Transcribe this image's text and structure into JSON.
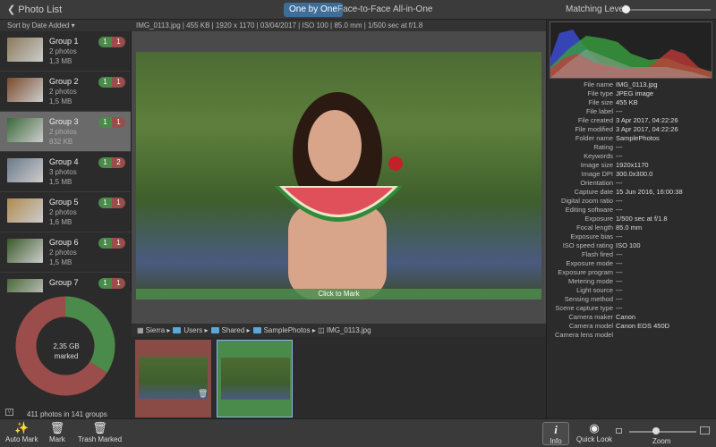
{
  "topbar": {
    "back": "Photo List",
    "modes": [
      "One by One",
      "Face-to-Face",
      "All-in-One"
    ],
    "active_mode": "One by One",
    "matching_label": "Matching Level:",
    "matching_level": 0
  },
  "sort": {
    "label": "Sort by Date Added"
  },
  "infobar": "IMG_0113.jpg | 455 KB | 1920 x 1170 | 03/04/2017 | ISO 100 | 85.0 mm | 1/500 sec at f/1.8",
  "groups": [
    {
      "name": "Group 1",
      "photos": "2 photos",
      "size": "1,3 MB",
      "keep": "1",
      "trash": "1"
    },
    {
      "name": "Group 2",
      "photos": "2 photos",
      "size": "1,5 MB",
      "keep": "1",
      "trash": "1"
    },
    {
      "name": "Group 3",
      "photos": "2 photos",
      "size": "832 KB",
      "keep": "1",
      "trash": "1",
      "selected": true
    },
    {
      "name": "Group 4",
      "photos": "3 photos",
      "size": "1,5 MB",
      "keep": "1",
      "trash": "2"
    },
    {
      "name": "Group 5",
      "photos": "2 photos",
      "size": "1,6 MB",
      "keep": "1",
      "trash": "1"
    },
    {
      "name": "Group 6",
      "photos": "2 photos",
      "size": "1,5 MB",
      "keep": "1",
      "trash": "1"
    },
    {
      "name": "Group 7",
      "photos": "",
      "size": "",
      "keep": "1",
      "trash": "1"
    }
  ],
  "donut": {
    "line1": "2,35 GB",
    "line2": "marked",
    "marked_fraction": 0.66,
    "colors": {
      "marked": "#9a4d4a",
      "kept": "#4a8a4a"
    }
  },
  "summary": "411 photos in 141 groups",
  "viewer": {
    "click_to_mark": "Click to Mark"
  },
  "breadcrumb": [
    "Sierra",
    "Users",
    "Shared",
    "SamplePhotos",
    "IMG_0113.jpg"
  ],
  "filmstrip": [
    {
      "state": "marked",
      "color": "#9a4d4a"
    },
    {
      "state": "kept",
      "color": "#4a8a4a",
      "selected": true
    }
  ],
  "metadata": [
    [
      "File name",
      "IMG_0113.jpg"
    ],
    [
      "File type",
      "JPEG image"
    ],
    [
      "File size",
      "455 KB"
    ],
    [
      "File label",
      "---"
    ],
    [
      "File created",
      "3 Apr 2017, 04:22:26"
    ],
    [
      "File modified",
      "3 Apr 2017, 04:22:26"
    ],
    [
      "Folder name",
      "SamplePhotos"
    ],
    [
      "Rating",
      "---"
    ],
    [
      "Keywords",
      "---"
    ],
    [
      "Image size",
      "1920x1170"
    ],
    [
      "Image DPI",
      "300.0x300.0"
    ],
    [
      "Orientation",
      "---"
    ],
    [
      "Capture date",
      "15 Jun 2016, 16:00:38"
    ],
    [
      "Digital zoom ratio",
      "---"
    ],
    [
      "Editing software",
      "---"
    ],
    [
      "Exposure",
      "1/500 sec at f/1.8"
    ],
    [
      "Focal length",
      "85.0 mm"
    ],
    [
      "Exposure bias",
      "---"
    ],
    [
      "ISO speed rating",
      "ISO 100"
    ],
    [
      "Flash fired",
      "---"
    ],
    [
      "Exposure mode",
      "---"
    ],
    [
      "Exposure program",
      "---"
    ],
    [
      "Metering mode",
      "---"
    ],
    [
      "Light source",
      "---"
    ],
    [
      "Sensing method",
      "---"
    ],
    [
      "Scene capture type",
      "---"
    ],
    [
      "Camera maker",
      "Canon"
    ],
    [
      "Camera model",
      "Canon EOS 450D"
    ],
    [
      "Camera lens model",
      ""
    ]
  ],
  "toolbar": {
    "auto_mark": "Auto Mark",
    "mark": "Mark",
    "trash_marked": "Trash Marked",
    "info": "Info",
    "quick_look": "Quick Look",
    "zoom": "Zoom",
    "zoom_level": 0.4
  }
}
